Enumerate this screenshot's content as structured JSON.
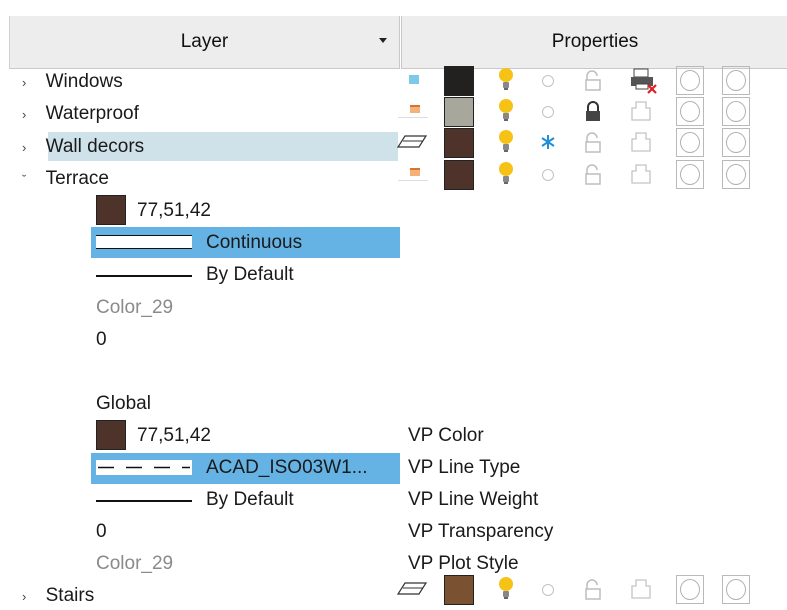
{
  "header": {
    "layer_label": "Layer",
    "properties_label": "Properties"
  },
  "colors": {
    "selection_blue": "#64b3e4",
    "selection_light": "#cfe2ea",
    "bulb_yellow": "#f6c216",
    "freeze_blue": "#1e90d8",
    "terrace_color": "#4d332a",
    "windows_color": "#23211f",
    "waterproof_color": "#a8a79c",
    "stairs_color": "#7a5232"
  },
  "layers": [
    {
      "name": "Windows",
      "expanded": false
    },
    {
      "name": "Waterproof",
      "expanded": false
    },
    {
      "name": "Wall decors",
      "expanded": false,
      "highlighted": true
    },
    {
      "name": "Terrace",
      "expanded": true
    },
    {
      "name": "Stairs",
      "expanded": false
    }
  ],
  "terrace": {
    "color_value": "77,51,42",
    "linetype": "Continuous",
    "lineweight": "By Default",
    "plot_style": "Color_29",
    "transparency": "0",
    "global_label": "Global",
    "vp_color_value": "77,51,42",
    "vp_linetype": "ACAD_ISO03W1...",
    "vp_lineweight": "By Default",
    "vp_transparency": "0",
    "vp_plot_style": "Color_29"
  },
  "vp_labels": [
    "VP Color",
    "VP Line Type",
    "VP Line Weight",
    "VP Transparency",
    "VP Plot Style"
  ]
}
